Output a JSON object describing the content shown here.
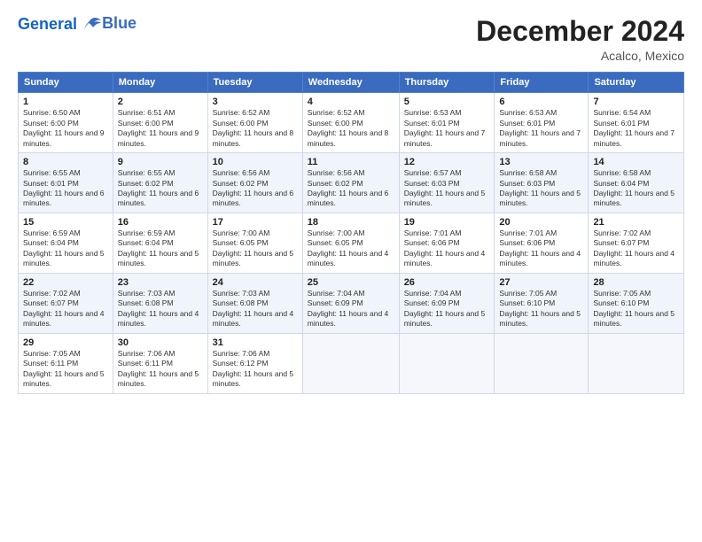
{
  "header": {
    "logo_line1": "General",
    "logo_line2": "Blue",
    "month_title": "December 2024",
    "location": "Acalco, Mexico"
  },
  "weekdays": [
    "Sunday",
    "Monday",
    "Tuesday",
    "Wednesday",
    "Thursday",
    "Friday",
    "Saturday"
  ],
  "weeks": [
    [
      {
        "day": "1",
        "sunrise": "6:50 AM",
        "sunset": "6:00 PM",
        "daylight": "11 hours and 9 minutes."
      },
      {
        "day": "2",
        "sunrise": "6:51 AM",
        "sunset": "6:00 PM",
        "daylight": "11 hours and 9 minutes."
      },
      {
        "day": "3",
        "sunrise": "6:52 AM",
        "sunset": "6:00 PM",
        "daylight": "11 hours and 8 minutes."
      },
      {
        "day": "4",
        "sunrise": "6:52 AM",
        "sunset": "6:00 PM",
        "daylight": "11 hours and 8 minutes."
      },
      {
        "day": "5",
        "sunrise": "6:53 AM",
        "sunset": "6:01 PM",
        "daylight": "11 hours and 7 minutes."
      },
      {
        "day": "6",
        "sunrise": "6:53 AM",
        "sunset": "6:01 PM",
        "daylight": "11 hours and 7 minutes."
      },
      {
        "day": "7",
        "sunrise": "6:54 AM",
        "sunset": "6:01 PM",
        "daylight": "11 hours and 7 minutes."
      }
    ],
    [
      {
        "day": "8",
        "sunrise": "6:55 AM",
        "sunset": "6:01 PM",
        "daylight": "11 hours and 6 minutes."
      },
      {
        "day": "9",
        "sunrise": "6:55 AM",
        "sunset": "6:02 PM",
        "daylight": "11 hours and 6 minutes."
      },
      {
        "day": "10",
        "sunrise": "6:56 AM",
        "sunset": "6:02 PM",
        "daylight": "11 hours and 6 minutes."
      },
      {
        "day": "11",
        "sunrise": "6:56 AM",
        "sunset": "6:02 PM",
        "daylight": "11 hours and 6 minutes."
      },
      {
        "day": "12",
        "sunrise": "6:57 AM",
        "sunset": "6:03 PM",
        "daylight": "11 hours and 5 minutes."
      },
      {
        "day": "13",
        "sunrise": "6:58 AM",
        "sunset": "6:03 PM",
        "daylight": "11 hours and 5 minutes."
      },
      {
        "day": "14",
        "sunrise": "6:58 AM",
        "sunset": "6:04 PM",
        "daylight": "11 hours and 5 minutes."
      }
    ],
    [
      {
        "day": "15",
        "sunrise": "6:59 AM",
        "sunset": "6:04 PM",
        "daylight": "11 hours and 5 minutes."
      },
      {
        "day": "16",
        "sunrise": "6:59 AM",
        "sunset": "6:04 PM",
        "daylight": "11 hours and 5 minutes."
      },
      {
        "day": "17",
        "sunrise": "7:00 AM",
        "sunset": "6:05 PM",
        "daylight": "11 hours and 5 minutes."
      },
      {
        "day": "18",
        "sunrise": "7:00 AM",
        "sunset": "6:05 PM",
        "daylight": "11 hours and 4 minutes."
      },
      {
        "day": "19",
        "sunrise": "7:01 AM",
        "sunset": "6:06 PM",
        "daylight": "11 hours and 4 minutes."
      },
      {
        "day": "20",
        "sunrise": "7:01 AM",
        "sunset": "6:06 PM",
        "daylight": "11 hours and 4 minutes."
      },
      {
        "day": "21",
        "sunrise": "7:02 AM",
        "sunset": "6:07 PM",
        "daylight": "11 hours and 4 minutes."
      }
    ],
    [
      {
        "day": "22",
        "sunrise": "7:02 AM",
        "sunset": "6:07 PM",
        "daylight": "11 hours and 4 minutes."
      },
      {
        "day": "23",
        "sunrise": "7:03 AM",
        "sunset": "6:08 PM",
        "daylight": "11 hours and 4 minutes."
      },
      {
        "day": "24",
        "sunrise": "7:03 AM",
        "sunset": "6:08 PM",
        "daylight": "11 hours and 4 minutes."
      },
      {
        "day": "25",
        "sunrise": "7:04 AM",
        "sunset": "6:09 PM",
        "daylight": "11 hours and 4 minutes."
      },
      {
        "day": "26",
        "sunrise": "7:04 AM",
        "sunset": "6:09 PM",
        "daylight": "11 hours and 5 minutes."
      },
      {
        "day": "27",
        "sunrise": "7:05 AM",
        "sunset": "6:10 PM",
        "daylight": "11 hours and 5 minutes."
      },
      {
        "day": "28",
        "sunrise": "7:05 AM",
        "sunset": "6:10 PM",
        "daylight": "11 hours and 5 minutes."
      }
    ],
    [
      {
        "day": "29",
        "sunrise": "7:05 AM",
        "sunset": "6:11 PM",
        "daylight": "11 hours and 5 minutes."
      },
      {
        "day": "30",
        "sunrise": "7:06 AM",
        "sunset": "6:11 PM",
        "daylight": "11 hours and 5 minutes."
      },
      {
        "day": "31",
        "sunrise": "7:06 AM",
        "sunset": "6:12 PM",
        "daylight": "11 hours and 5 minutes."
      },
      null,
      null,
      null,
      null
    ]
  ]
}
